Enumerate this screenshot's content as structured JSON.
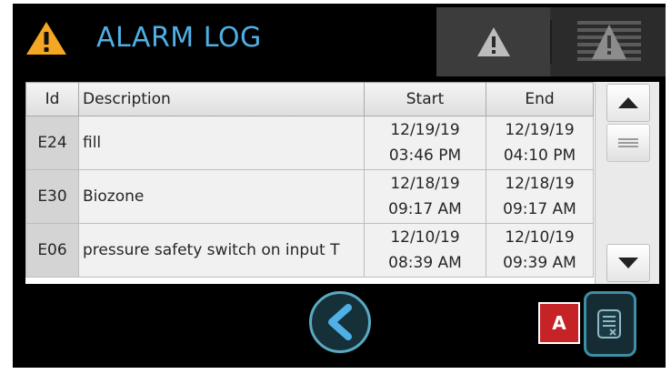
{
  "header": {
    "title": "ALARM LOG",
    "warning_icon": "warning-triangle-icon",
    "tabs": [
      {
        "name": "active-alarms",
        "icon": "warning-triangle-icon",
        "selected": true
      },
      {
        "name": "alarm-history",
        "icon": "warning-list-icon",
        "selected": false
      }
    ]
  },
  "table": {
    "columns": [
      "Id",
      "Description",
      "Start",
      "End"
    ],
    "rows": [
      {
        "id": "E24",
        "description": "fill",
        "start_date": "12/19/19",
        "start_time": "03:46 PM",
        "end_date": "12/19/19",
        "end_time": "04:10 PM"
      },
      {
        "id": "E30",
        "description": "Biozone",
        "start_date": "12/18/19",
        "start_time": "09:17 AM",
        "end_date": "12/18/19",
        "end_time": "09:17 AM"
      },
      {
        "id": "E06",
        "description": "pressure safety switch on input T",
        "start_date": "12/10/19",
        "start_time": "08:39 AM",
        "end_date": "12/10/19",
        "end_time": "09:39 AM"
      }
    ]
  },
  "footer": {
    "back_icon": "chevron-left-icon",
    "clear_icon": "clear-log-icon",
    "marker_label": "A"
  },
  "colors": {
    "title": "#4fb0e6",
    "warning": "#f5a623",
    "marker": "#c52326",
    "button_border": "#5aa9c0"
  }
}
